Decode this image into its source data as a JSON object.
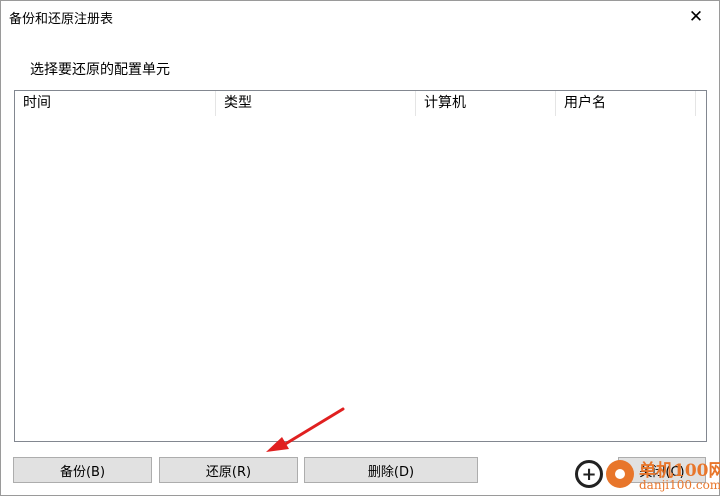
{
  "window": {
    "title": "备份和还原注册表",
    "close_glyph": "✕"
  },
  "prompt": "选择要还原的配置单元",
  "list": {
    "columns": [
      "时间",
      "类型",
      "计算机",
      "用户名"
    ],
    "rows": []
  },
  "buttons": {
    "backup": "备份(B)",
    "restore": "还原(R)",
    "delete": "删除(D)",
    "close": "关闭(C)"
  },
  "annotation": {
    "arrow_color": "#e02020"
  },
  "watermark": {
    "brand": "单机100网",
    "url": "danji100.com",
    "accent_color": "#e8762b"
  }
}
